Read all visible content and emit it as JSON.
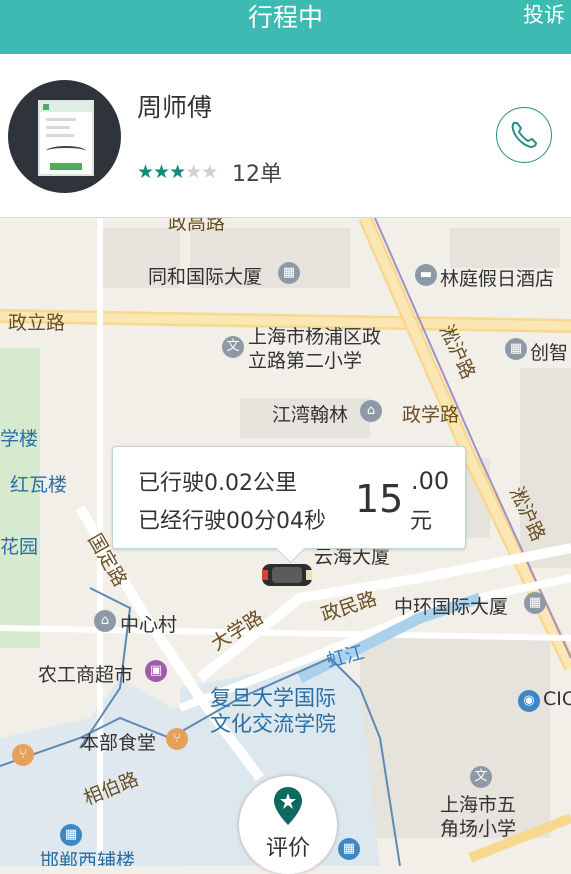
{
  "header": {
    "title": "行程中",
    "complain_label": "投诉"
  },
  "driver": {
    "name": "周师傅",
    "rating": 3,
    "rating_max": 5,
    "orders": "12单"
  },
  "trip": {
    "distance": "已行驶0.02公里",
    "duration": "已经行驶00分04秒",
    "fare_int": "15",
    "fare_dec": ".00",
    "fare_unit": "元"
  },
  "map": {
    "labels": [
      "政高路",
      "同和国际大厦",
      "林庭假日酒店",
      "政立路",
      "上海市杨浦区政",
      "立路第二小学",
      "创智",
      "江湾翰林",
      "政学路",
      "淞沪路",
      "学楼",
      "红瓦楼",
      "花园",
      "国定路",
      "云海大厦",
      "中心村",
      "大学路",
      "政民路",
      "中环国际大厦",
      "农工商超市",
      "虹江",
      "复旦大学国际",
      "文化交流学院",
      "CIC",
      "本部食堂",
      "相伯路",
      "上海市五",
      "角场小学",
      "邯郸西辅楼"
    ]
  },
  "actions": {
    "rate_label": "评价"
  },
  "colors": {
    "accent": "#3dbbb2",
    "star_on": "#0f8a7c"
  }
}
